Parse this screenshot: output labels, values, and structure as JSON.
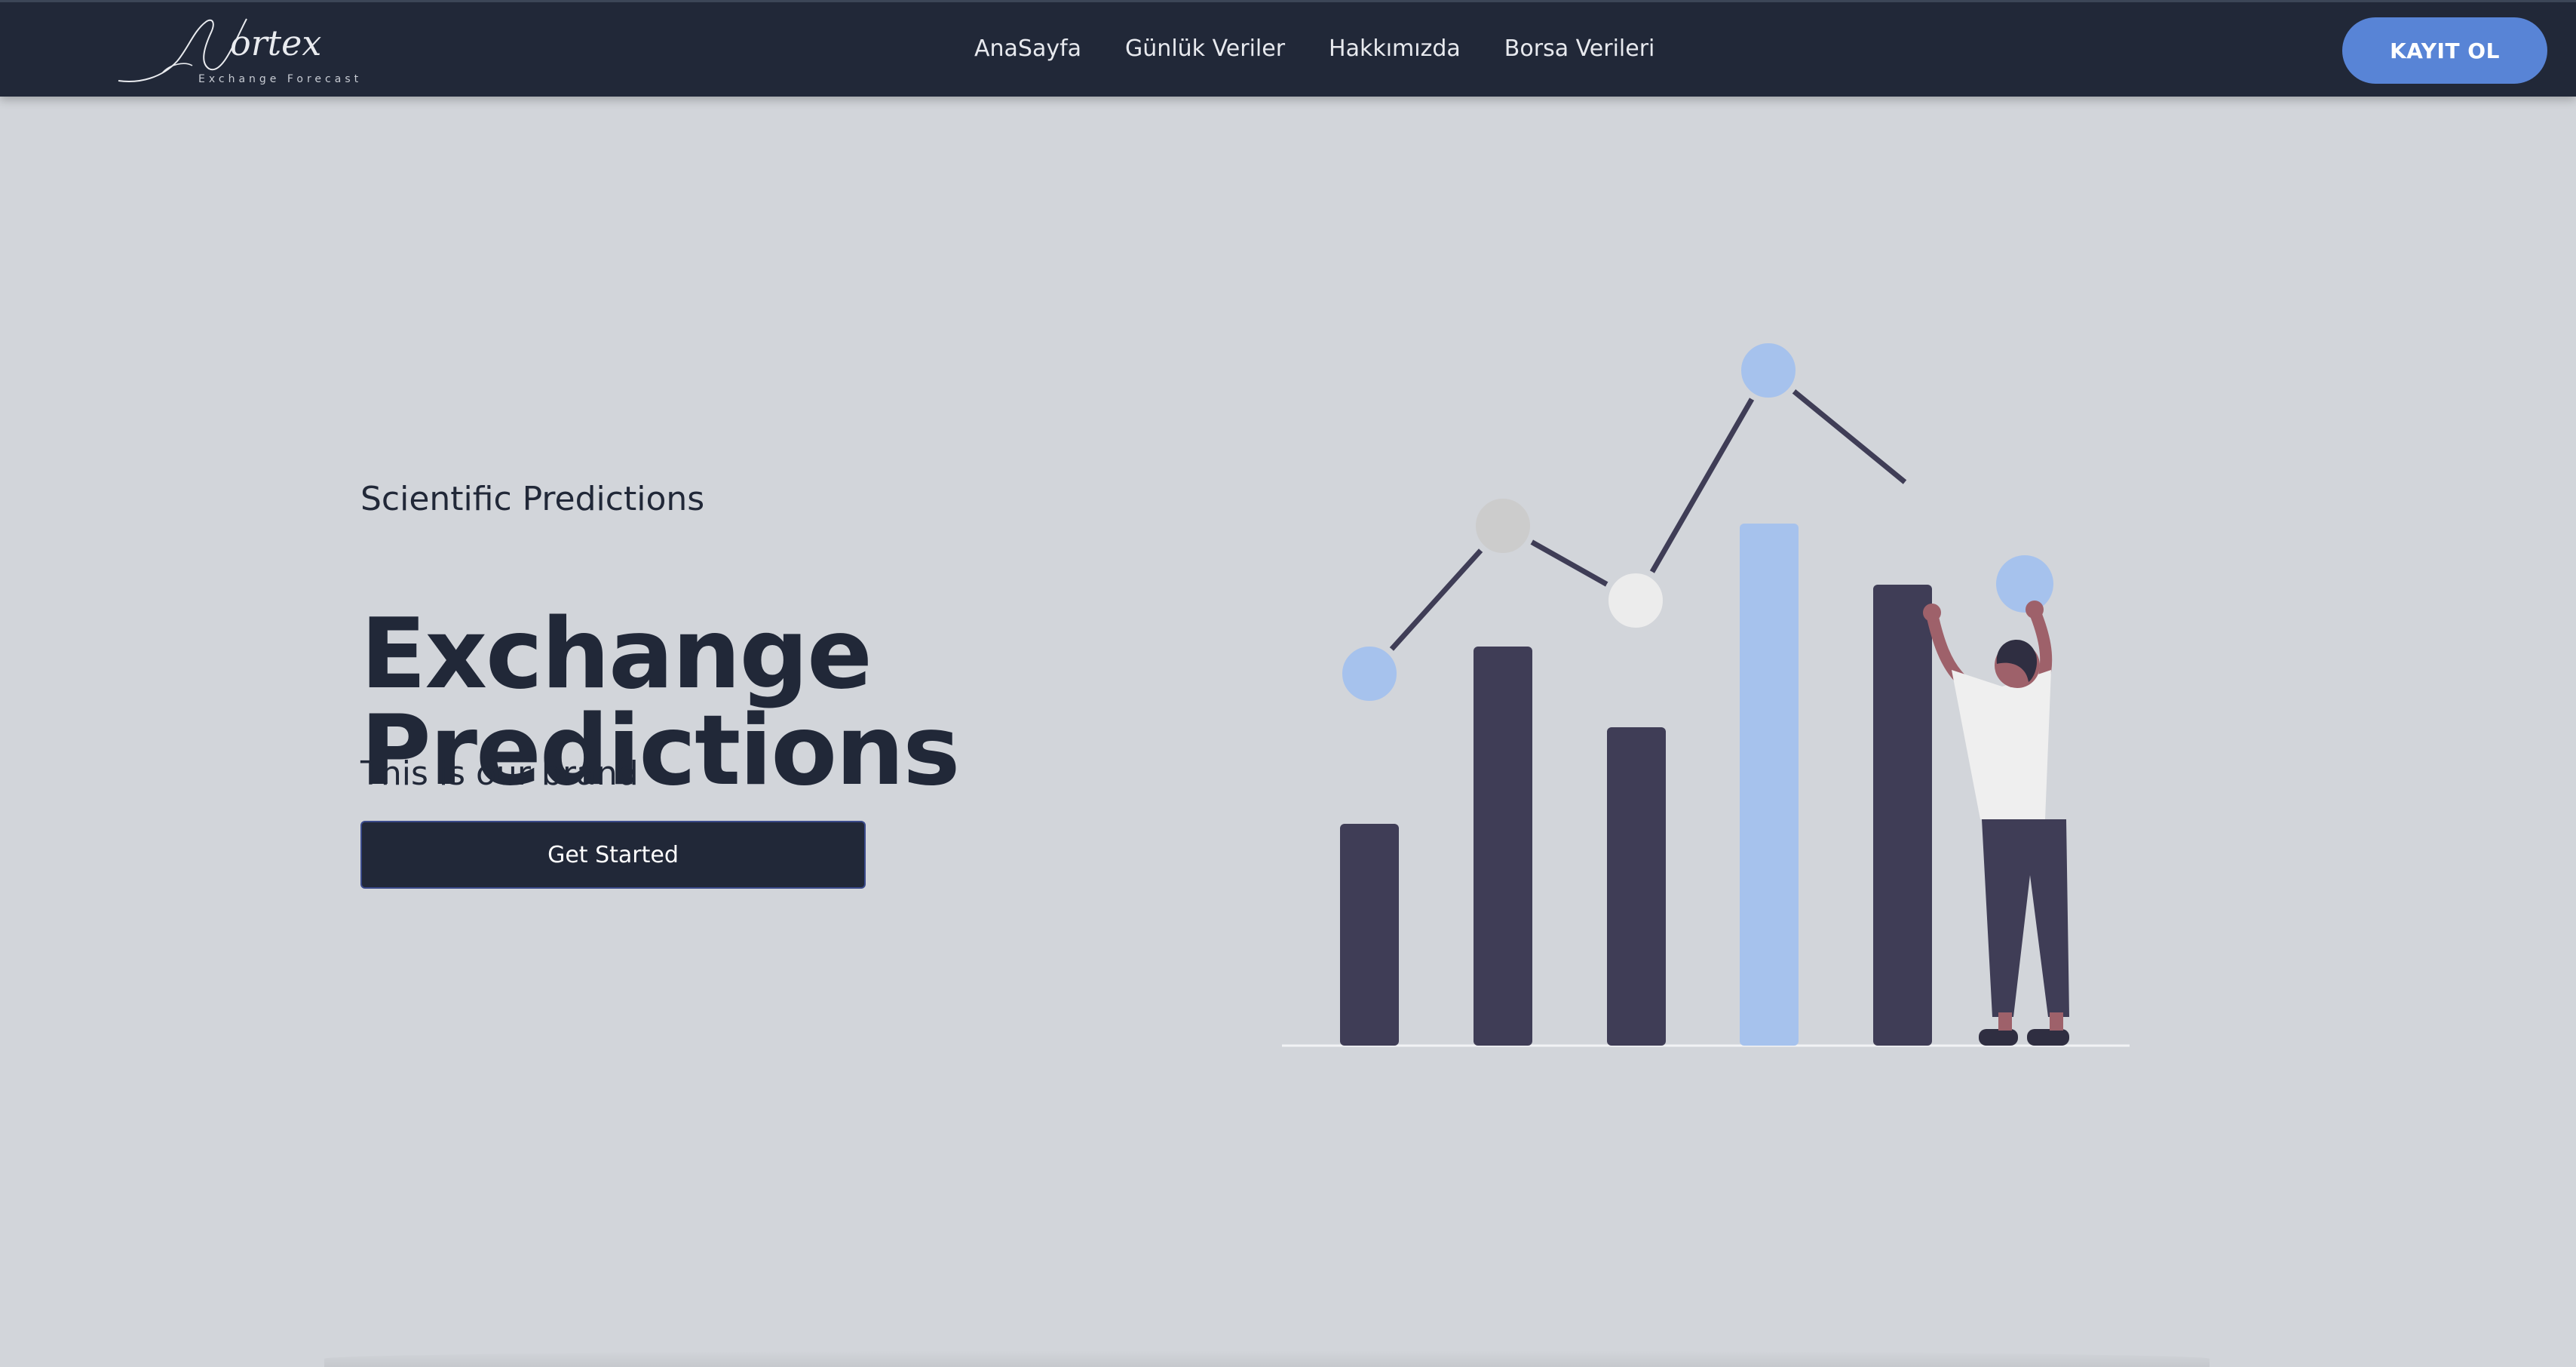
{
  "brand": {
    "name": "Vortex",
    "tagline": "Exchange Forecast"
  },
  "nav": {
    "items": [
      {
        "label": "AnaSayfa"
      },
      {
        "label": "Günlük Veriler"
      },
      {
        "label": "Hakkımızda"
      },
      {
        "label": "Borsa Verileri"
      }
    ],
    "signup_label": "KAYIT OL"
  },
  "hero": {
    "eyebrow": "Scientific Predictions",
    "title_line1": "Exchange",
    "title_line2": "Predictions",
    "subtitle": "This is our brand",
    "cta_label": "Get Started"
  },
  "colors": {
    "navbar_bg": "#212838",
    "page_bg": "#d2d5da",
    "accent": "#5884d6",
    "bar_dark": "#3f3d56",
    "bar_highlight": "#a6c2ed",
    "text_dark": "#212838"
  }
}
